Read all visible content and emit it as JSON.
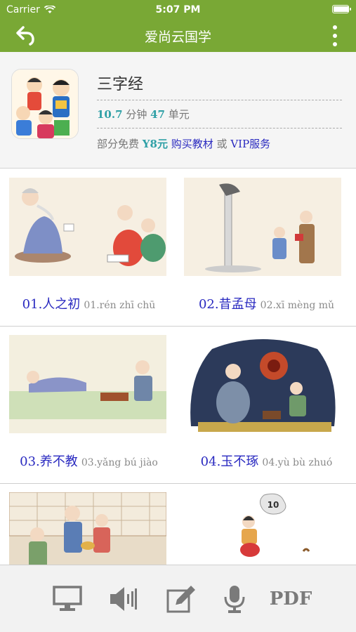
{
  "status_bar": {
    "carrier": "Carrier",
    "time": "5:07 PM",
    "battery_level": 1.0
  },
  "nav": {
    "title": "爱尚云国学",
    "back_icon": "back-arrow-icon",
    "more_icon": "more-vertical-icon"
  },
  "book": {
    "title": "三字经",
    "duration_value": "10.7",
    "duration_unit": "分钟",
    "unit_count": "47",
    "unit_label": "单元",
    "free_label": "部分免费",
    "price": "Y8元",
    "buy_label": "购买教材",
    "or_label": "或",
    "vip_label": "VIP服务"
  },
  "lessons": [
    {
      "title": "01.人之初",
      "pinyin": "01.rén zhī chū"
    },
    {
      "title": "02.昔孟母",
      "pinyin": "02.xī mèng mǔ"
    },
    {
      "title": "03.养不教",
      "pinyin": "03.yǎng bú jiào"
    },
    {
      "title": "04.玉不琢",
      "pinyin": "04.yù bù zhuó"
    },
    {
      "title": "",
      "pinyin": ""
    },
    {
      "title": "",
      "pinyin": ""
    }
  ],
  "illustration_badge": "10",
  "tabs": [
    {
      "icon": "monitor-icon"
    },
    {
      "icon": "speaker-icon"
    },
    {
      "icon": "edit-icon"
    },
    {
      "icon": "microphone-icon"
    },
    {
      "icon": "pdf-icon",
      "label": "PDF"
    }
  ],
  "colors": {
    "nav_green": "#79a835",
    "link_blue": "#2a2ac0",
    "accent_teal": "#2fa0a6"
  }
}
